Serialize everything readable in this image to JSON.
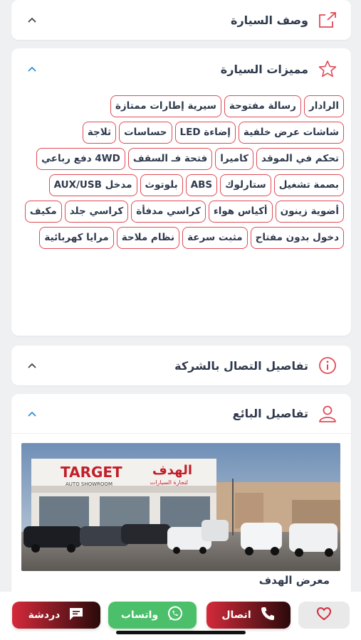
{
  "sections": {
    "description": {
      "title": "وصف السيارة"
    },
    "features": {
      "title": "مميزات السيارة",
      "items": [
        "الرادار",
        "رسالة مفتوحة",
        "سيرية إطارات ممتازة",
        "شاشات عرض خلفية",
        "إضاءة LED",
        "حساسات",
        "ثلاجة",
        "تحكم في الموقد",
        "كاميرا",
        "فتحة فـ السقف",
        "4WD دفع رباعي",
        "بصمة تشغيل",
        "ستارلوك",
        "ABS",
        "بلوتوث",
        "مدخل AUX/USB",
        "أضوية زينون",
        "أكياس هواء",
        "كراسي مدفأة",
        "كراسي جلد",
        "مكيف",
        "دخول بدون مفتاح",
        "مثبت سرعة",
        "نظام ملاحة",
        "مرايا كهربائية"
      ]
    },
    "contact": {
      "title": "تفاصيل التصال بالشركة"
    },
    "seller": {
      "title": "تفاصيل البائع",
      "name": "معرض الهدف",
      "sign_text": "TARGET",
      "sign_sub": "AUTO SHOWROOM",
      "sign_ar": "الهدف",
      "sign_ar_sub": "لتجارة السيارات"
    }
  },
  "actions": {
    "chat": "دردشة",
    "whatsapp": "واتساب",
    "call": "اتصال"
  },
  "colors": {
    "accent": "#e04a55",
    "whatsapp": "#4cbf6a",
    "blue_chevron": "#2f8fd6"
  }
}
